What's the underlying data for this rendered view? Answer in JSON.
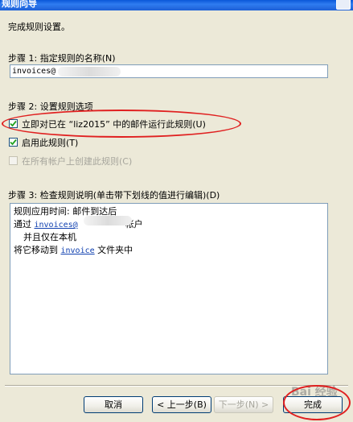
{
  "window": {
    "title": "规则向导"
  },
  "intro": "完成规则设置。",
  "step1": {
    "label": "步骤 1: 指定规则的名称(N)",
    "name_value": "invoices@"
  },
  "step2": {
    "label": "步骤 2: 设置规则选项",
    "options": [
      {
        "label": "立即对已在 “liz2015” 中的邮件运行此规则(U)",
        "checked": true,
        "enabled": true
      },
      {
        "label": "启用此规则(T)",
        "checked": true,
        "enabled": true
      },
      {
        "label": "在所有帐户上创建此规则(C)",
        "checked": false,
        "enabled": false
      }
    ]
  },
  "step3": {
    "label": "步骤 3: 检查规则说明(单击带下划线的值进行编辑)(D)",
    "line1": "规则应用时间: 邮件到达后",
    "line2_prefix": "通过",
    "line2_link": "invoices@",
    "line2_suffix": "帐户",
    "line3": "并且仅在本机",
    "line4_prefix": "将它移动到",
    "line4_link": "invoice",
    "line4_suffix": "文件夹中"
  },
  "buttons": {
    "cancel": "取消",
    "back": "< 上一步(B)",
    "next": "下一步(N) >",
    "finish": "完成"
  },
  "watermark": "Bai 经验"
}
